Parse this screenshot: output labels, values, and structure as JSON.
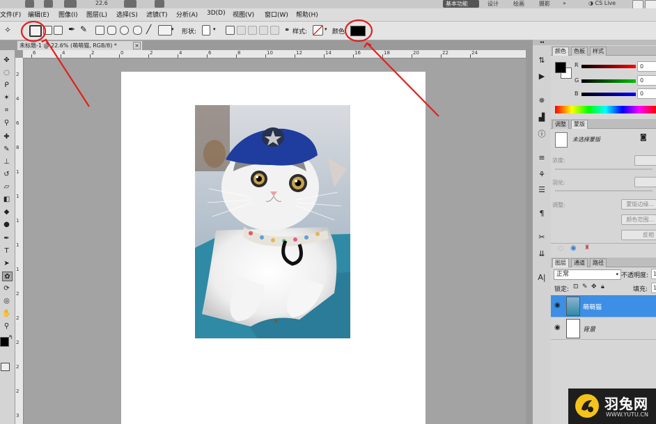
{
  "app": {
    "zoom_value": "22.6",
    "right_buttons": [
      "基本功能",
      "设计",
      "绘画",
      "摄影"
    ],
    "cs_live": "CS Live"
  },
  "menu": [
    "文件(F)",
    "编辑(E)",
    "图像(I)",
    "图层(L)",
    "选择(S)",
    "滤镜(T)",
    "分析(A)",
    "3D(D)",
    "视图(V)",
    "窗口(W)",
    "帮助(H)"
  ],
  "options_bar": {
    "shape_label": "形状:",
    "style_label": "样式:",
    "color_label": "颜色",
    "color_value": "#000000"
  },
  "document_tab": {
    "title": "未标题-1 @ 22.6% (萌萌猫, RGB/8) *",
    "close": "×"
  },
  "ruler": {
    "h_ticks": [
      "6",
      "4",
      "2",
      "0",
      "2",
      "4",
      "6",
      "8",
      "10",
      "12",
      "14",
      "16",
      "18",
      "20",
      "22",
      "24"
    ],
    "v_ticks": [
      "2",
      "4",
      "6",
      "8",
      "1",
      "1",
      "1",
      "1",
      "1",
      "2",
      "2",
      "2",
      "2",
      "2",
      "3"
    ]
  },
  "color_panel": {
    "tabs": [
      "颜色",
      "色板",
      "样式"
    ],
    "r_label": "R",
    "g_label": "G",
    "b_label": "B",
    "r_value": "0",
    "g_value": "0",
    "b_value": "0",
    "foreground": "#000000",
    "background": "#ffffff"
  },
  "adjust_panel": {
    "tabs": [
      "调整",
      "蒙版"
    ],
    "mask_status": "未选择蒙版",
    "density_label": "浓度:",
    "feather_label": "羽化:",
    "refine_label": "调整:",
    "buttons": [
      "蒙版边缘...",
      "颜色范围...",
      "反相"
    ]
  },
  "layers_panel": {
    "tabs": [
      "图层",
      "通道",
      "路径"
    ],
    "blend_mode": "正常",
    "opacity_label": "不透明度:",
    "opacity_value": "1",
    "lock_label": "锁定:",
    "fill_label": "填充:",
    "fill_value": "1",
    "layers": [
      {
        "name": "萌萌猫",
        "selected": true
      },
      {
        "name": "背景",
        "selected": false
      }
    ]
  },
  "watermark": {
    "brand": "羽兔网",
    "url": "WWW.YUTU.CN"
  },
  "colors": {
    "annotation_red": "#e0201c",
    "layer_selected": "#3d8fe6",
    "hat_blue": "#1f3d9e",
    "table_teal": "#2f8aa6",
    "watermark_yellow": "#f4c21a"
  }
}
